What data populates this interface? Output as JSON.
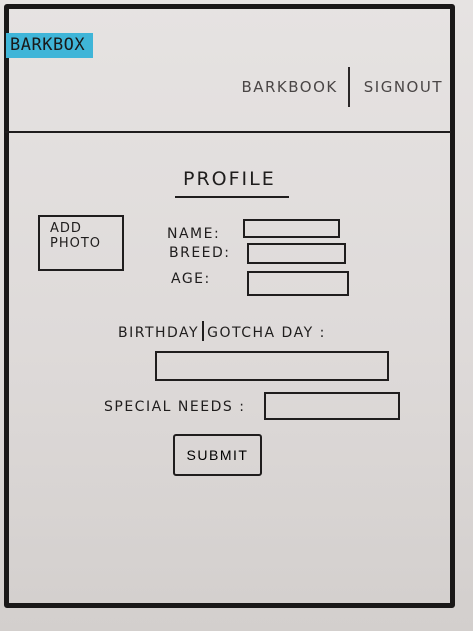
{
  "header": {
    "logo": "BARKBOX",
    "nav": [
      {
        "label": "BARKBOOK"
      },
      {
        "label": "SIGNOUT"
      }
    ]
  },
  "profile": {
    "title": "PROFILE",
    "add_photo": [
      "ADD",
      "PHOTO"
    ],
    "labels": {
      "name": "NAME:",
      "breed": "BREED:",
      "age": "AGE:",
      "birthday": "BIRTHDAY",
      "gotcha": "GOTCHA DAY :",
      "special_needs": "SPECIAL NEEDS :"
    },
    "submit": "SUBMIT"
  }
}
